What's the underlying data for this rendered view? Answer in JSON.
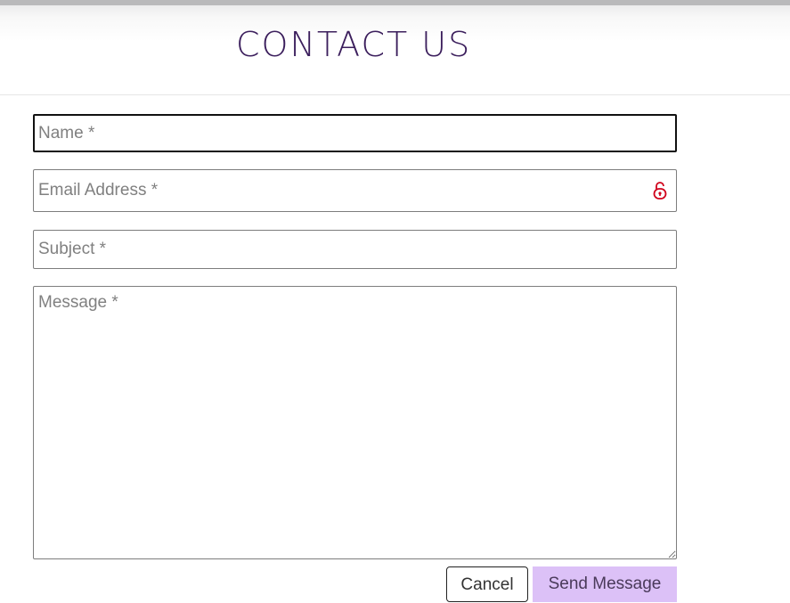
{
  "header": {
    "title": "CONTACT US"
  },
  "form": {
    "name_placeholder": "Name *",
    "email_placeholder": "Email Address *",
    "subject_placeholder": "Subject *",
    "message_placeholder": "Message *",
    "email_icon": "lock-icon",
    "email_icon_color": "#d0021b"
  },
  "actions": {
    "cancel_label": "Cancel",
    "send_label": "Send Message",
    "send_color": "#dcc1f7"
  },
  "colors": {
    "title": "#3b1e5c"
  }
}
